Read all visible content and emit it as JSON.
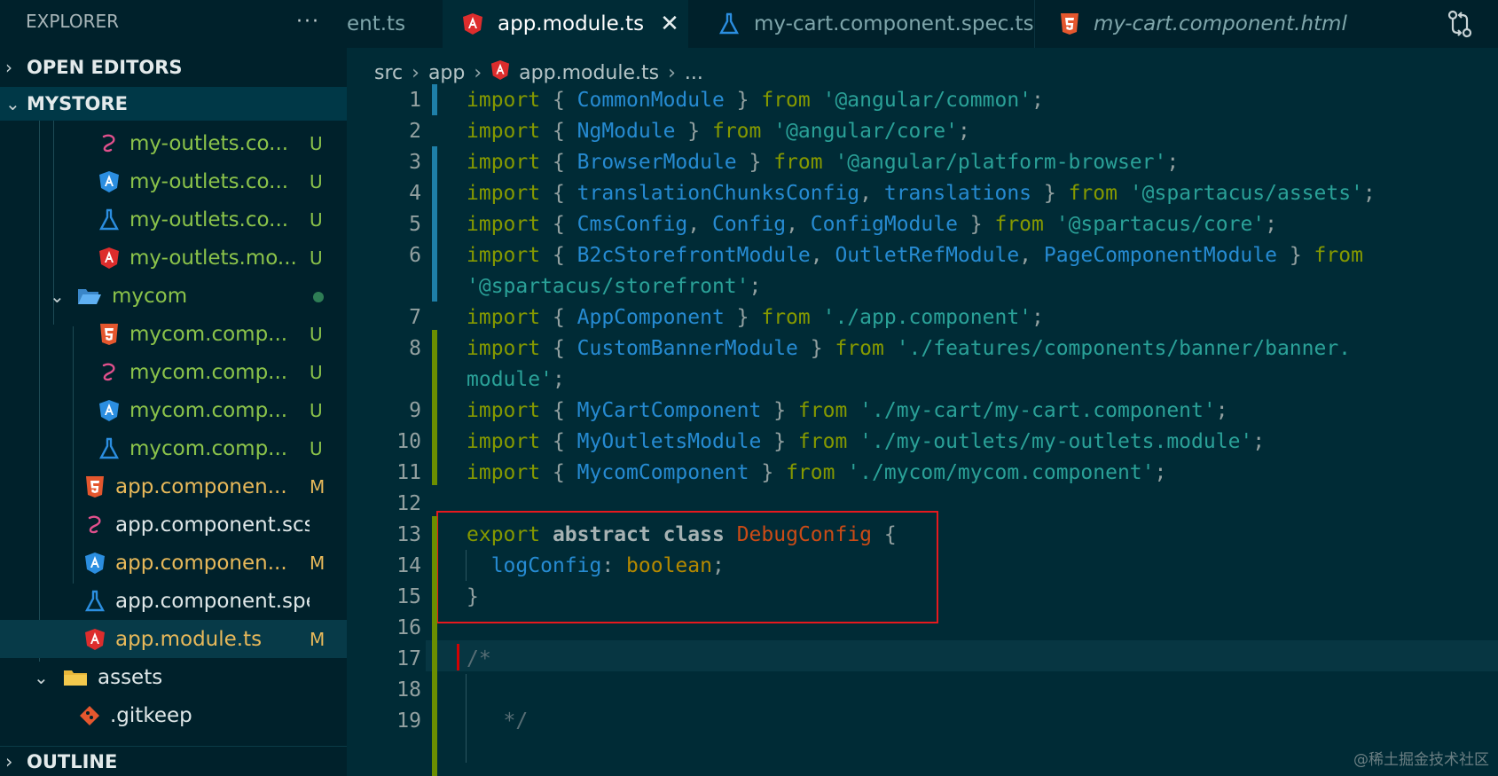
{
  "sidebar": {
    "title": "EXPLORER",
    "more": "···",
    "open_editors": "OPEN EDITORS",
    "project": "MYSTORE",
    "outline": "OUTLINE",
    "items": [
      {
        "label": "my-outlets.co...",
        "badge": "U",
        "icon": "sass-icon"
      },
      {
        "label": "my-outlets.co...",
        "badge": "U",
        "icon": "angular-component-icon"
      },
      {
        "label": "my-outlets.co...",
        "badge": "U",
        "icon": "test-flask-icon"
      },
      {
        "label": "my-outlets.mo...",
        "badge": "U",
        "icon": "angular-module-icon"
      },
      {
        "label": "mycom",
        "badge": "",
        "icon": "folder-open-icon"
      },
      {
        "label": "mycom.comp...",
        "badge": "U",
        "icon": "html5-icon"
      },
      {
        "label": "mycom.comp...",
        "badge": "U",
        "icon": "sass-icon"
      },
      {
        "label": "mycom.comp...",
        "badge": "U",
        "icon": "angular-component-icon"
      },
      {
        "label": "mycom.comp...",
        "badge": "U",
        "icon": "test-flask-icon"
      },
      {
        "label": "app.componen...",
        "badge": "M",
        "icon": "html5-icon"
      },
      {
        "label": "app.component.scss",
        "badge": "",
        "icon": "sass-icon"
      },
      {
        "label": "app.componen...",
        "badge": "M",
        "icon": "angular-component-icon"
      },
      {
        "label": "app.component.spec...",
        "badge": "",
        "icon": "test-flask-icon"
      },
      {
        "label": "app.module.ts",
        "badge": "M",
        "icon": "angular-module-icon"
      },
      {
        "label": "assets",
        "badge": "",
        "icon": "folder-icon"
      },
      {
        "label": ".gitkeep",
        "badge": "",
        "icon": "git-icon"
      }
    ]
  },
  "tabs": [
    {
      "label": "ent.ts"
    },
    {
      "label": "app.module.ts",
      "close": "✕"
    },
    {
      "label": "my-cart.component.spec.ts"
    },
    {
      "label": "my-cart.component.html"
    }
  ],
  "breadcrumb": {
    "src": "src",
    "app": "app",
    "file": "app.module.ts",
    "more": "..."
  },
  "line_numbers": [
    "1",
    "2",
    "3",
    "4",
    "5",
    "6",
    "7",
    "8",
    "9",
    "10",
    "11",
    "12",
    "13",
    "14",
    "15",
    "16",
    "17",
    "18",
    "19"
  ],
  "code": {
    "import": "import",
    "from": "from",
    "export": "export",
    "abstract": "abstract",
    "class": "class",
    "l1_id": "CommonModule",
    "l1_str": "'@angular/common'",
    "l2_id": "NgModule",
    "l2_str": "'@angular/core'",
    "l3_id": "BrowserModule",
    "l3_str": "'@angular/platform-browser'",
    "l4_id1": "translationChunksConfig",
    "l4_id2": "translations",
    "l4_str": "'@spartacus/assets'",
    "l5_id1": "CmsConfig",
    "l5_id2": "Config",
    "l5_id3": "ConfigModule",
    "l5_str": "'@spartacus/core'",
    "l6_id1": "B2cStorefrontModule",
    "l6_id2": "OutletRefModule",
    "l6_id3": "PageComponentModule",
    "l6_str": "'@spartacus/storefront'",
    "l7_id": "AppComponent",
    "l7_str": "'./app.component'",
    "l8_id": "CustomBannerModule",
    "l8_str1": "'./features/components/banner/banner.",
    "l8_str2": "module'",
    "l9_id": "MyCartComponent",
    "l9_str": "'./my-cart/my-cart.component'",
    "l10_id": "MyOutletsModule",
    "l10_str": "'./my-outlets/my-outlets.module'",
    "l11_id": "MycomComponent",
    "l11_str": "'./mycom/mycom.component'",
    "l13_cls": "DebugConfig",
    "l14_prop": "logConfig",
    "l14_type": "boolean",
    "l17": "/*",
    "l19": "*/"
  },
  "watermark": "@稀土掘金技术社区"
}
